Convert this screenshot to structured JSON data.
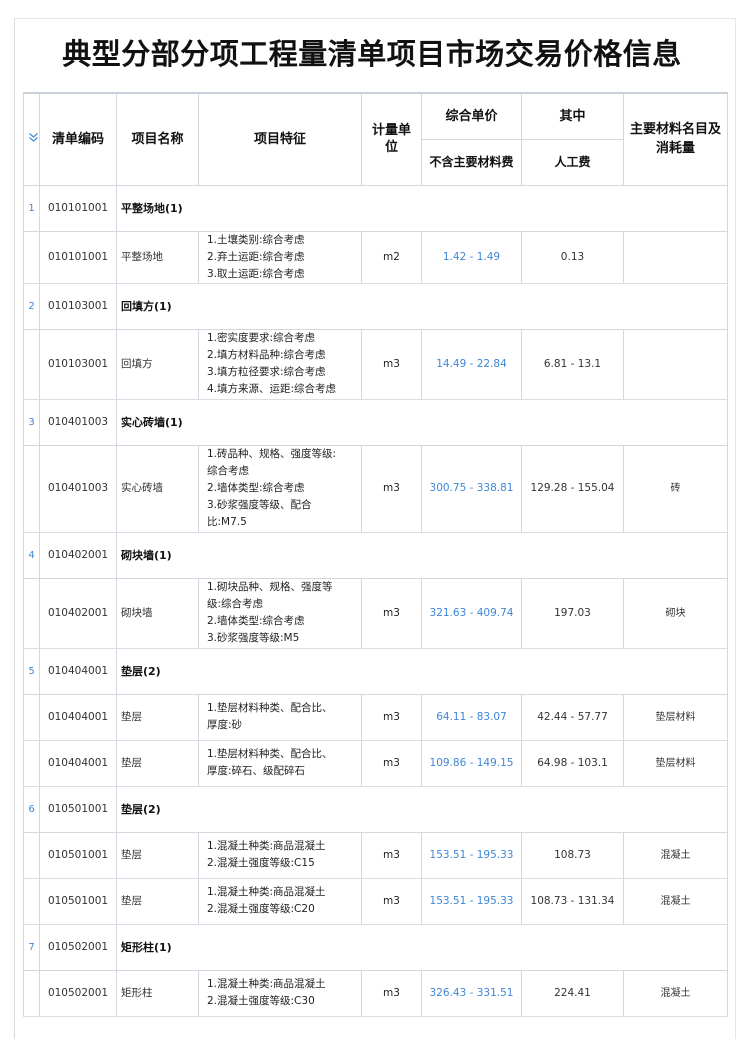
{
  "title": "典型分部分项工程量清单项目市场交易价格信息",
  "icons": {
    "expand": "chevron-double-down-icon"
  },
  "headers": {
    "code": "清单编码",
    "name": "项目名称",
    "feature": "项目特征",
    "unit": "计量单位",
    "composite_price": "综合单价",
    "composite_sub": "不含主要材料费",
    "among": "其中",
    "labor": "人工费",
    "materials": "主要材料名目及消耗量"
  },
  "groups": [
    {
      "index": "1",
      "code": "010101001",
      "title": "平整场地(1)",
      "items": [
        {
          "code": "010101001",
          "name": "平整场地",
          "features": [
            "1.土壤类别:综合考虑",
            "2.弃土运距:综合考虑",
            "3.取土运距:综合考虑"
          ],
          "unit": "m2",
          "price": "1.42 - 1.49",
          "labor": "0.13",
          "material": ""
        }
      ]
    },
    {
      "index": "2",
      "code": "010103001",
      "title": "回填方(1)",
      "items": [
        {
          "code": "010103001",
          "name": "回填方",
          "features": [
            "1.密实度要求:综合考虑",
            "2.填方材料品种:综合考虑",
            "3.填方粒径要求:综合考虑",
            "4.填方来源、运距:综合考虑"
          ],
          "unit": "m3",
          "price": "14.49 - 22.84",
          "labor": "6.81 - 13.1",
          "material": ""
        }
      ]
    },
    {
      "index": "3",
      "code": "010401003",
      "title": "实心砖墙(1)",
      "items": [
        {
          "code": "010401003",
          "name": "实心砖墙",
          "features": [
            "1.砖品种、规格、强度等级:",
            "综合考虑",
            "2.墙体类型:综合考虑",
            "3.砂浆强度等级、配合",
            "比:M7.5"
          ],
          "unit": "m3",
          "price": "300.75 - 338.81",
          "labor": "129.28 - 155.04",
          "material": "砖"
        }
      ]
    },
    {
      "index": "4",
      "code": "010402001",
      "title": "砌块墙(1)",
      "items": [
        {
          "code": "010402001",
          "name": "砌块墙",
          "features": [
            "1.砌块品种、规格、强度等",
            "级:综合考虑",
            "2.墙体类型:综合考虑",
            "3.砂浆强度等级:M5"
          ],
          "unit": "m3",
          "price": "321.63 - 409.74",
          "labor": "197.03",
          "material": "砌块"
        }
      ]
    },
    {
      "index": "5",
      "code": "010404001",
      "title": "垫层(2)",
      "items": [
        {
          "code": "010404001",
          "name": "垫层",
          "features": [
            "1.垫层材料种类、配合比、",
            "厚度:砂"
          ],
          "unit": "m3",
          "price": "64.11 - 83.07",
          "labor": "42.44 - 57.77",
          "material": "垫层材料"
        },
        {
          "code": "010404001",
          "name": "垫层",
          "features": [
            "1.垫层材料种类、配合比、",
            "厚度:碎石、级配碎石"
          ],
          "unit": "m3",
          "price": "109.86 - 149.15",
          "labor": "64.98 - 103.1",
          "material": "垫层材料"
        }
      ]
    },
    {
      "index": "6",
      "code": "010501001",
      "title": "垫层(2)",
      "items": [
        {
          "code": "010501001",
          "name": "垫层",
          "features": [
            "1.混凝土种类:商品混凝土",
            "2.混凝土强度等级:C15"
          ],
          "unit": "m3",
          "price": "153.51 - 195.33",
          "labor": "108.73",
          "material": "混凝土"
        },
        {
          "code": "010501001",
          "name": "垫层",
          "features": [
            "1.混凝土种类:商品混凝土",
            "2.混凝土强度等级:C20"
          ],
          "unit": "m3",
          "price": "153.51 - 195.33",
          "labor": "108.73 - 131.34",
          "material": "混凝土"
        }
      ]
    },
    {
      "index": "7",
      "code": "010502001",
      "title": "矩形柱(1)",
      "items": [
        {
          "code": "010502001",
          "name": "矩形柱",
          "features": [
            "1.混凝土种类:商品混凝土",
            "2.混凝土强度等级:C30"
          ],
          "unit": "m3",
          "price": "326.43 - 331.51",
          "labor": "224.41",
          "material": "混凝土"
        }
      ]
    }
  ]
}
